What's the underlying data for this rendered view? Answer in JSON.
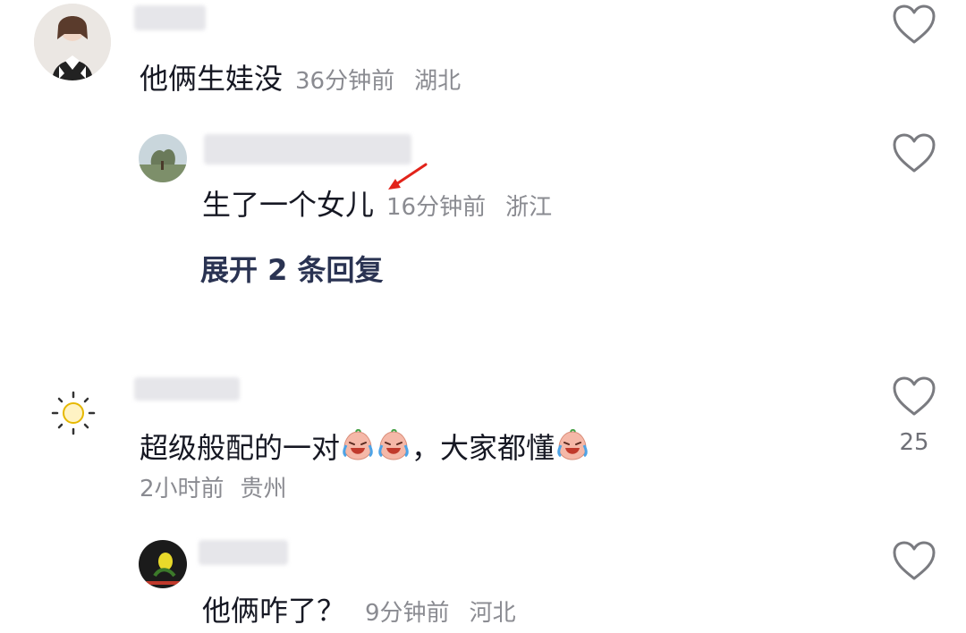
{
  "colors": {
    "text": "#161823",
    "meta": "#8a8b91",
    "link": "#2a3352",
    "arrow": "#e2231a"
  },
  "comments": [
    {
      "text": "他俩生娃没",
      "time": "36分钟前",
      "location": "湖北",
      "icon": "heart-outline-icon",
      "reply": {
        "text": "生了一个女儿",
        "time": "16分钟前",
        "location": "浙江",
        "icon": "heart-outline-icon",
        "expand_label": "展开 2 条回复"
      }
    },
    {
      "text_part1": "超级般配的一对",
      "text_part2": "，大家都懂",
      "emoji": "crying-laughing-emoji",
      "time": "2小时前",
      "location": "贵州",
      "like_count": "25",
      "icon": "heart-outline-icon",
      "avatar_icon": "sun-icon",
      "reply": {
        "text": "他俩咋了？",
        "time": "9分钟前",
        "location": "河北",
        "icon": "heart-outline-icon"
      }
    }
  ]
}
